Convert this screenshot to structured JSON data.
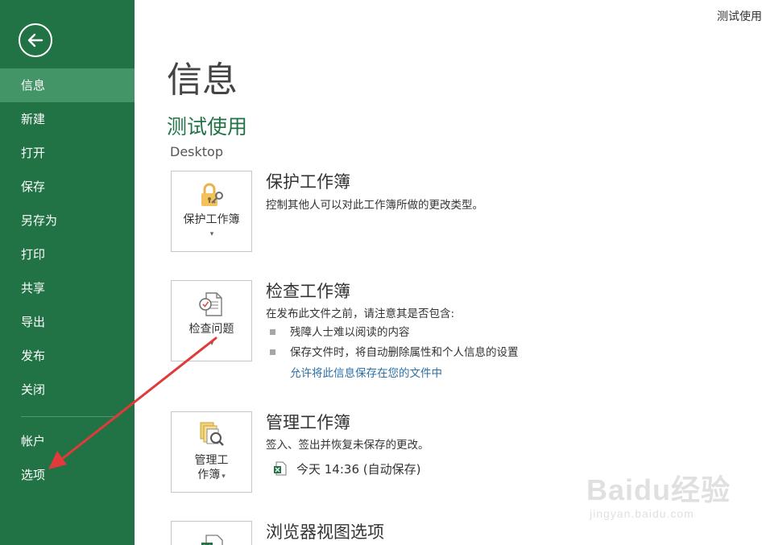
{
  "header": {
    "user_name": "测试使用"
  },
  "sidebar": {
    "items": [
      {
        "label": "信息"
      },
      {
        "label": "新建"
      },
      {
        "label": "打开"
      },
      {
        "label": "保存"
      },
      {
        "label": "另存为"
      },
      {
        "label": "打印"
      },
      {
        "label": "共享"
      },
      {
        "label": "导出"
      },
      {
        "label": "发布"
      },
      {
        "label": "关闭"
      },
      {
        "label": "帐户"
      },
      {
        "label": "选项"
      }
    ]
  },
  "main": {
    "title": "信息",
    "file_name": "测试使用",
    "file_location": "Desktop",
    "protect": {
      "button_label": "保护工作簿",
      "title": "保护工作簿",
      "description": "控制其他人可以对此工作簿所做的更改类型。"
    },
    "inspect": {
      "button_label": "检查问题",
      "title": "检查工作簿",
      "description": "在发布此文件之前，请注意其是否包含:",
      "bullets": [
        "残障人士难以阅读的内容",
        "保存文件时，将自动删除属性和个人信息的设置"
      ],
      "link": "允许将此信息保存在您的文件中"
    },
    "manage": {
      "button_label_1": "管理工",
      "button_label_2": "作簿",
      "title": "管理工作簿",
      "description": "签入、签出并恢复未保存的更改。",
      "version": "今天 14:36 (自动保存)"
    },
    "browser": {
      "title": "浏览器视图选项"
    }
  },
  "watermark": {
    "brand": "Baidu经验",
    "url": "jingyan.baidu.com"
  },
  "colors": {
    "sidebar": "#217346",
    "active": "#439467",
    "accent_green": "#217346",
    "link": "#2a6fa8",
    "annotation_arrow": "#e03a3a"
  }
}
